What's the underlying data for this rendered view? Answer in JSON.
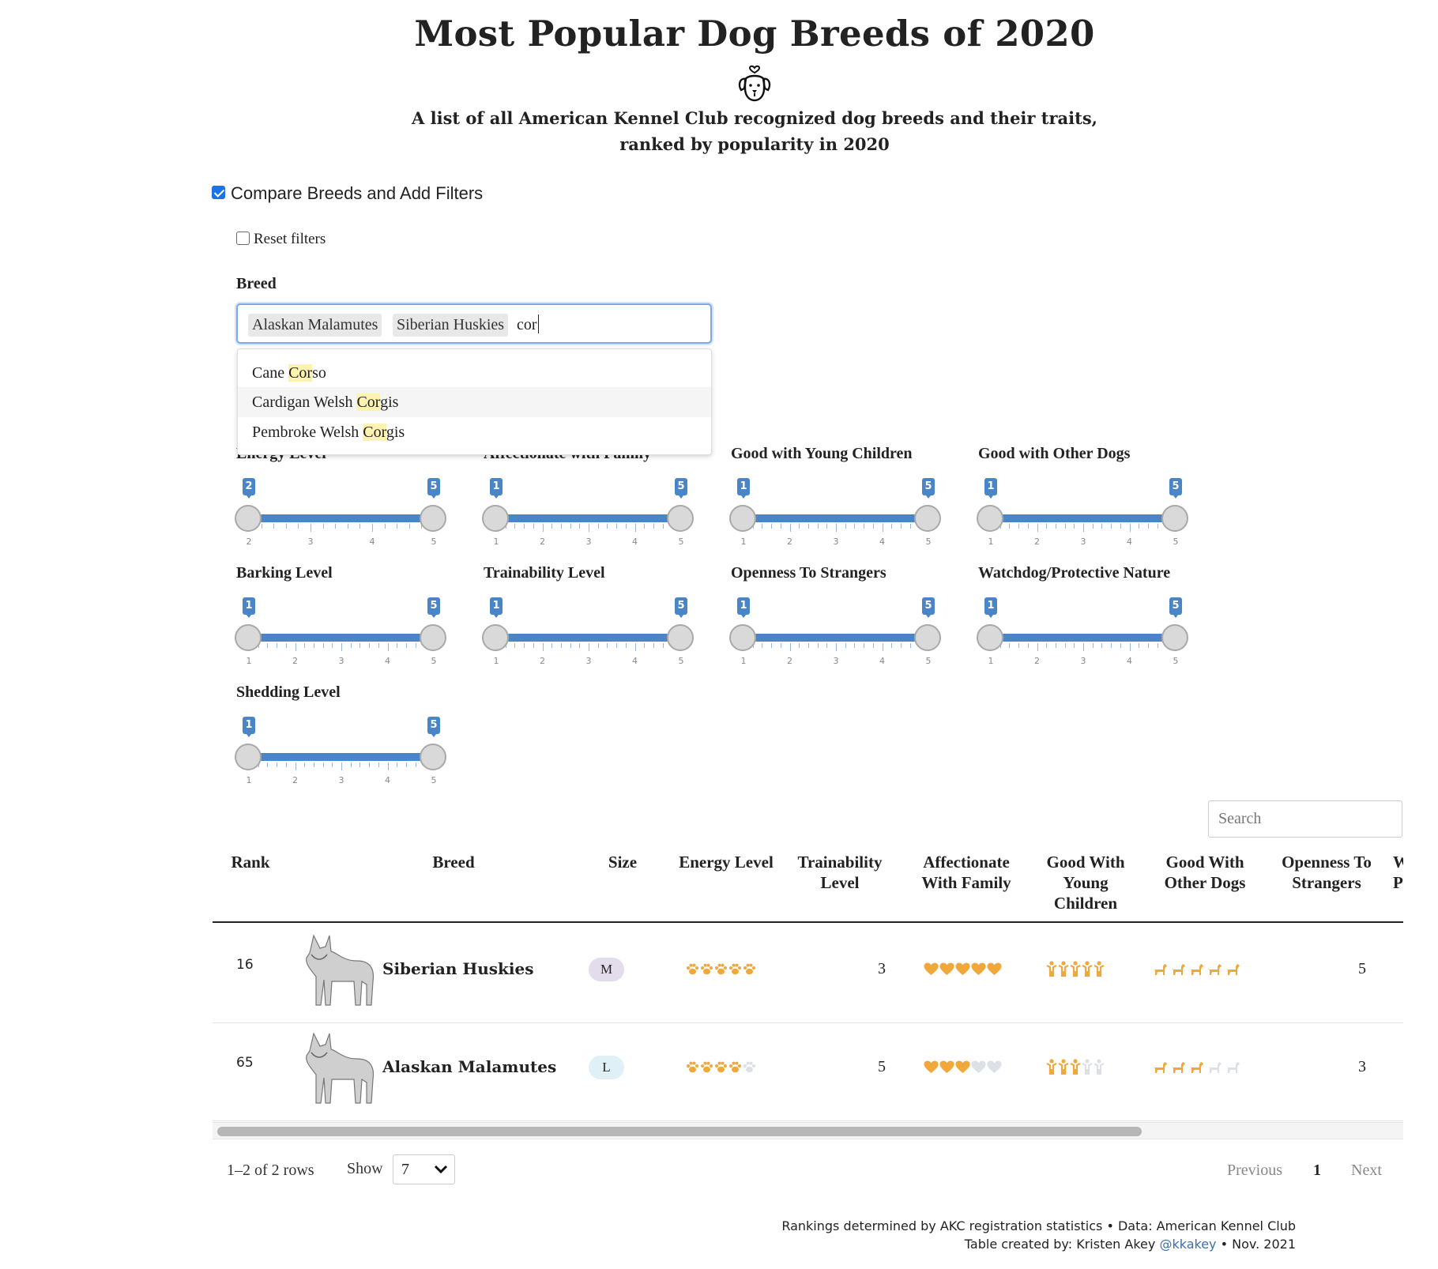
{
  "header": {
    "title": "Most Popular Dog Breeds of 2020",
    "subtitle_line1": "A list of all American Kennel Club recognized dog breeds and their traits,",
    "subtitle_line2": "ranked by popularity in 2020"
  },
  "controls": {
    "compare_label": "Compare Breeds and Add Filters",
    "compare_checked": true,
    "reset_label": "Reset filters",
    "reset_checked": false,
    "breed_label": "Breed",
    "breed_tags": [
      "Alaskan Malamutes",
      "Siberian Huskies"
    ],
    "breed_typed": "cor",
    "dropdown": [
      {
        "pre": "Cane ",
        "match": "Cor",
        "post": "so"
      },
      {
        "pre": "Cardigan Welsh ",
        "match": "Cor",
        "post": "gis"
      },
      {
        "pre": "Pembroke Welsh ",
        "match": "Cor",
        "post": "gis"
      }
    ]
  },
  "sliders": [
    {
      "label": "Energy Level",
      "min": 2,
      "max": 5,
      "range": [
        2,
        5
      ]
    },
    {
      "label": "Affectionate with Family",
      "min": 1,
      "max": 5,
      "range": [
        1,
        5
      ]
    },
    {
      "label": "Good with Young Children",
      "min": 1,
      "max": 5,
      "range": [
        1,
        5
      ]
    },
    {
      "label": "Good with Other Dogs",
      "min": 1,
      "max": 5,
      "range": [
        1,
        5
      ]
    },
    {
      "label": "Barking Level",
      "min": 1,
      "max": 5,
      "range": [
        1,
        5
      ]
    },
    {
      "label": "Trainability Level",
      "min": 1,
      "max": 5,
      "range": [
        1,
        5
      ]
    },
    {
      "label": "Openness To Strangers",
      "min": 1,
      "max": 5,
      "range": [
        1,
        5
      ]
    },
    {
      "label": "Watchdog/Protective Nature",
      "min": 1,
      "max": 5,
      "range": [
        1,
        5
      ]
    },
    {
      "label": "Shedding Level",
      "min": 1,
      "max": 5,
      "range": [
        1,
        5
      ]
    }
  ],
  "table": {
    "search_placeholder": "Search",
    "columns": {
      "rank": "Rank",
      "breed": "Breed",
      "size": "Size",
      "energy": "Energy Level",
      "trainability_1": "Trainability",
      "trainability_2": "Level",
      "affectionate_1": "Affectionate",
      "affectionate_2": "With Family",
      "children_1": "Good With",
      "children_2": "Young",
      "children_3": "Children",
      "dogs_1": "Good With",
      "dogs_2": "Other Dogs",
      "openness_1": "Openness To",
      "openness_2": "Strangers",
      "watchdog_1": "W",
      "watchdog_2": "P"
    },
    "rows": [
      {
        "rank": "16",
        "breed": "Siberian Huskies",
        "size": "M",
        "size_color": "#e2dcec",
        "energy": 5,
        "trainability": "3",
        "affectionate": 5,
        "children": 5,
        "dogs": 5,
        "openness": "5"
      },
      {
        "rank": "65",
        "breed": "Alaskan Malamutes",
        "size": "L",
        "size_color": "#e0f0f7",
        "energy": 4,
        "trainability": "5",
        "affectionate": 3,
        "children": 3,
        "dogs": 3,
        "openness": "3"
      }
    ],
    "rows_info": "1–2 of 2 rows",
    "show_label": "Show",
    "show_value": "7",
    "prev": "Previous",
    "page": "1",
    "next": "Next"
  },
  "footer": {
    "line1": "Rankings determined by AKC registration statistics • Data: American Kennel Club",
    "line2_pre": "Table created by: Kristen Akey ",
    "line2_link": "@kkakey",
    "line2_post": " • Nov. 2021"
  },
  "colors": {
    "accent": "#4a85c8",
    "rating_on": "#f0a83a",
    "rating_off": "#dde1e6"
  }
}
